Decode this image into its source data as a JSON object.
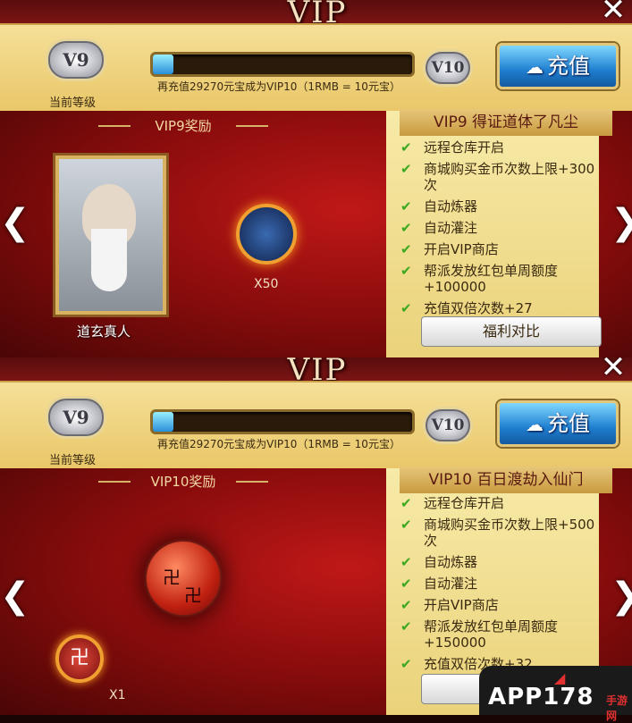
{
  "title": "VIP",
  "current_level_label": "当前等级",
  "current_level_badge": "V9",
  "next_level_badge": "V10",
  "progress_fraction": 0.08,
  "progress_text": "再充值29270元宝成为VIP10（1RMB = 10元宝）",
  "recharge_label": "充值",
  "panels": [
    {
      "rewards_title": "VIP9奖励",
      "reward_card_name": "道玄真人",
      "reward_item_count": "X50",
      "benefits_title": "VIP9 得证道体了凡尘",
      "benefits": [
        "远程仓库开启",
        "商城购买金币次数上限+300次",
        "自动炼器",
        "自动灌注",
        "开启VIP商店",
        "帮派发放红包单周额度+100000",
        "充值双倍次数+27"
      ],
      "compare_label": "福利对比"
    },
    {
      "rewards_title": "VIP10奖励",
      "reward_item_count": "X1",
      "benefits_title": "VIP10 百日渡劫入仙门",
      "benefits": [
        "远程仓库开启",
        "商城购买金币次数上限+500次",
        "自动炼器",
        "自动灌注",
        "开启VIP商店",
        "帮派发放红包单周额度+150000",
        "充值双倍次数+32"
      ]
    }
  ],
  "watermark": {
    "text": "APP178",
    "sub": "手游网"
  },
  "colors": {
    "accent_blue": "#1f7fd0",
    "gold": "#e9c768",
    "red": "#c01818",
    "check": "#3aa820"
  }
}
